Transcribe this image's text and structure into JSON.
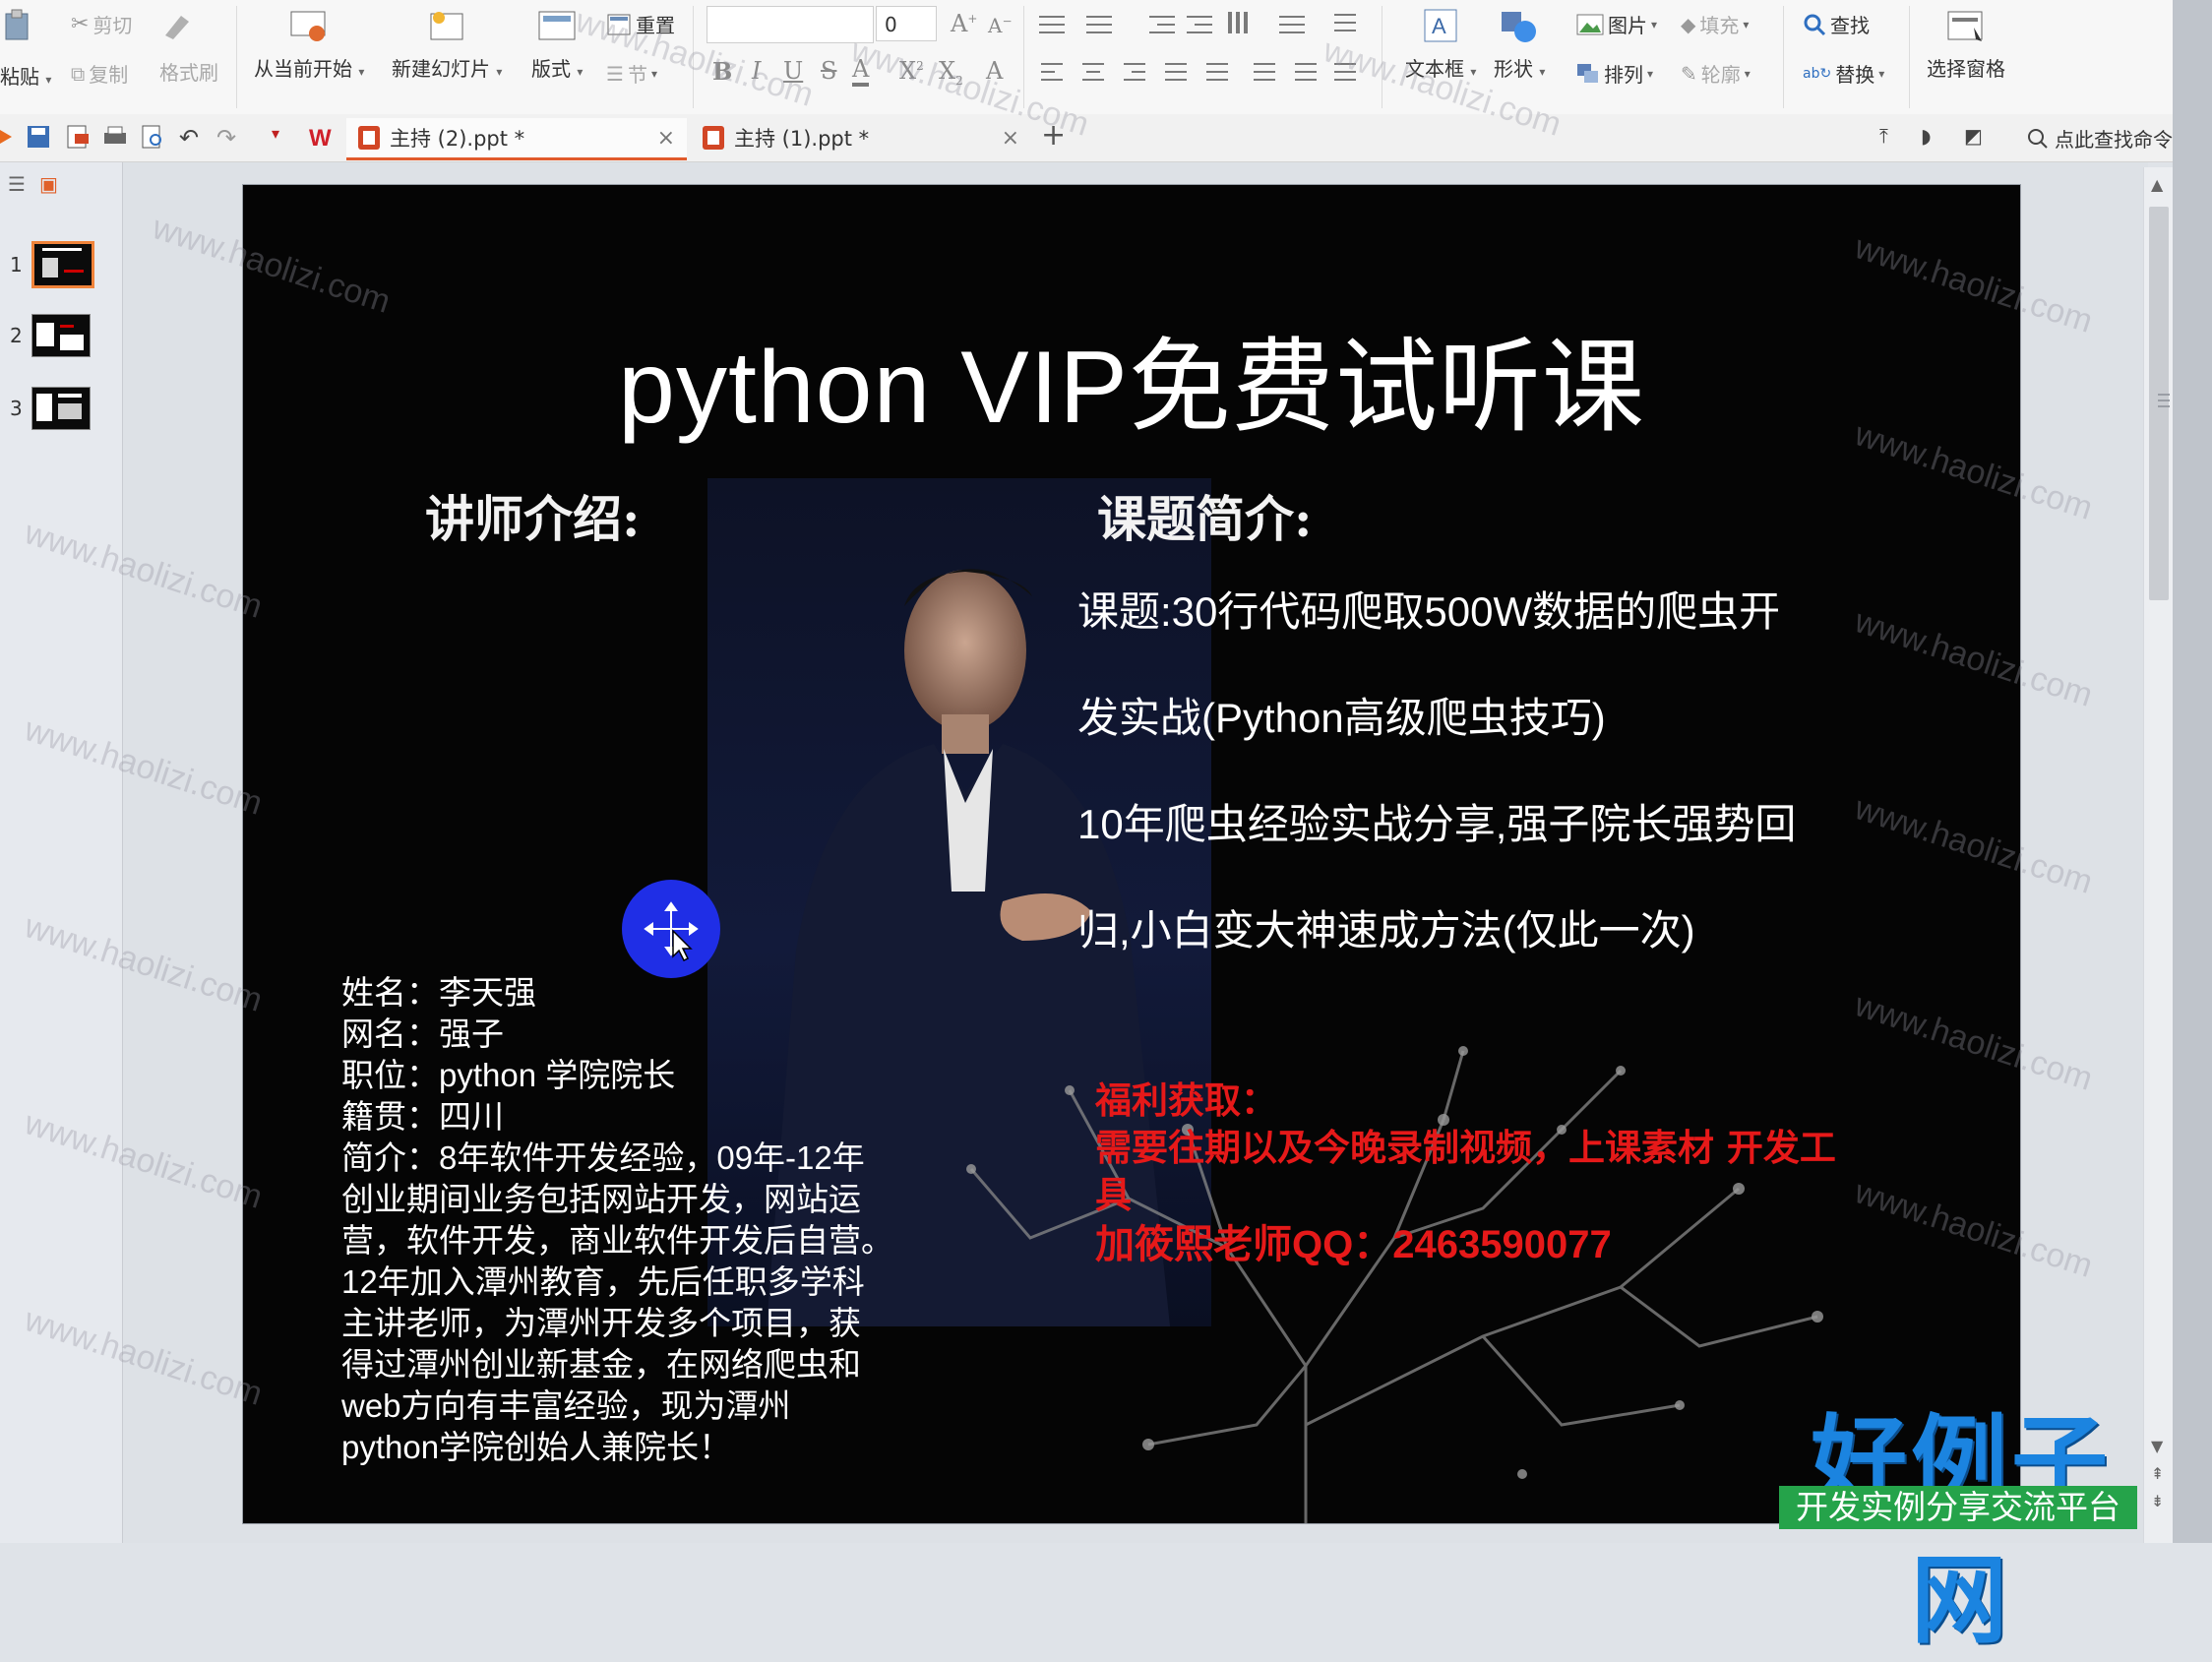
{
  "ribbon": {
    "paste": "粘贴",
    "cut": "剪切",
    "copy": "复制",
    "format_painter": "格式刷",
    "from_current": "从当前开始",
    "new_slide": "新建幻灯片",
    "layout": "版式",
    "reset": "重置",
    "section": "节",
    "font_size": "0",
    "text_box": "文本框",
    "shape": "形状",
    "picture": "图片",
    "fill": "填充",
    "arrange": "排列",
    "outline": "轮廓",
    "find": "查找",
    "replace": "替换",
    "selection_pane": "选择窗格"
  },
  "tabs": [
    {
      "label": "主持 (2).ppt *",
      "active": true
    },
    {
      "label": "主持 (1).ppt *",
      "active": false
    }
  ],
  "tabbar": {
    "new_tab": "+",
    "search_command": "点此查找命令"
  },
  "thumbnails": [
    {
      "num": "1",
      "active": true
    },
    {
      "num": "2",
      "active": false
    },
    {
      "num": "3",
      "active": false
    }
  ],
  "slide": {
    "title": "python VIP免费试听课",
    "instructor_heading": "讲师介绍:",
    "course_heading": "课题简介:",
    "course_lines": [
      "课题:30行代码爬取500W数据的爬虫开",
      "发实战(Python高级爬虫技巧)",
      "10年爬虫经验实战分享,强子院长强势回",
      "归,小白变大神速成方法(仅此一次)"
    ],
    "bio_lines": [
      "姓名：李天强",
      "网名：强子",
      "职位：python 学院院长",
      "籍贯：四川",
      "简介：8年软件开发经验，09年-12年",
      "创业期间业务包括网站开发，网站运",
      "营，软件开发，商业软件开发后自营。",
      "12年加入潭州教育，先后任职多学科",
      "主讲老师，为潭州开发多个项目，获",
      "得过潭州创业新基金，在网络爬虫和",
      "web方向有丰富经验，现为潭州",
      "python学院创始人兼院长！"
    ],
    "promo_lines": [
      "福利获取：",
      "需要往期以及今晚录制视频，上课素材 开发工",
      "具",
      "加筱熙老师QQ：2463590077"
    ]
  },
  "watermark": "www.haolizi.com",
  "brand": {
    "name": "好例子网",
    "slogan": "开发实例分享交流平台"
  },
  "colors": {
    "accent_orange": "#e05a2b",
    "promo_red": "#e61919",
    "cursor_blue": "#1f2ee6",
    "brand_blue": "#1b84e0",
    "brand_green": "#25a34a"
  }
}
